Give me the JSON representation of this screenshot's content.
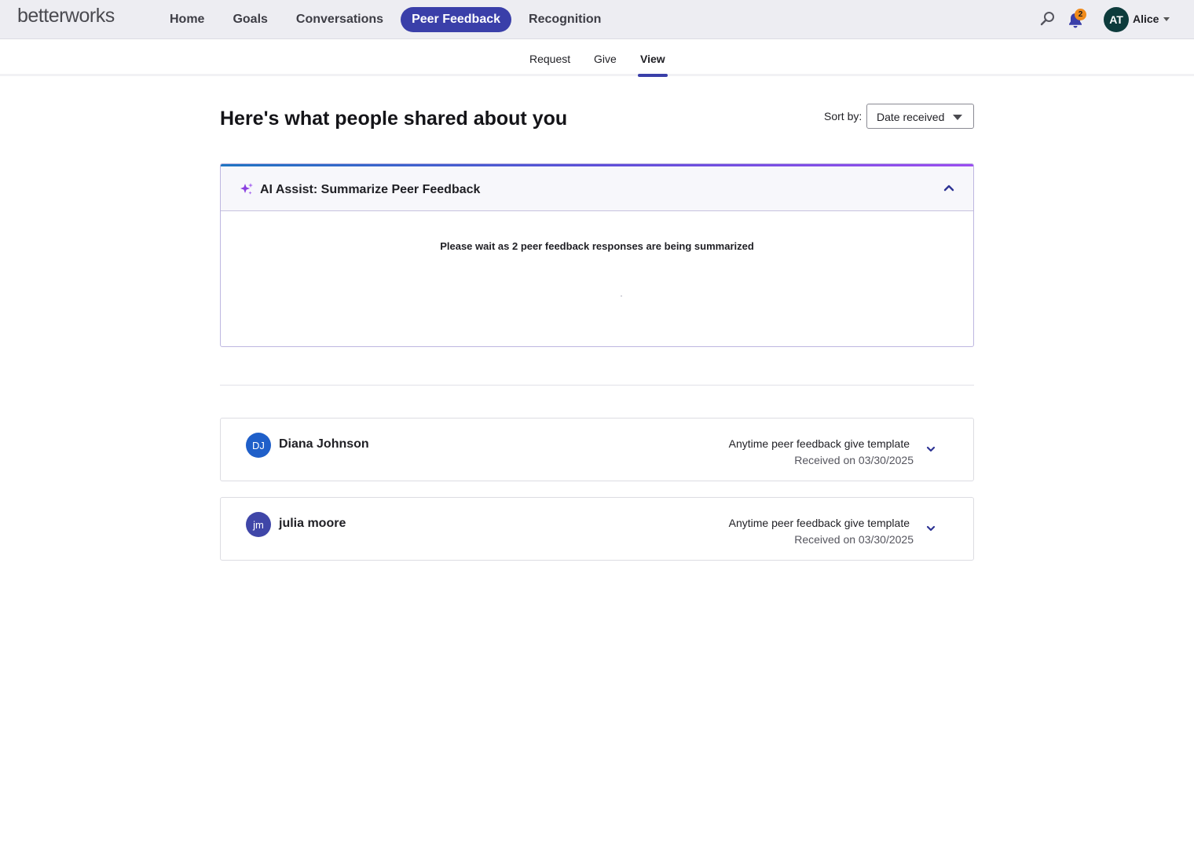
{
  "brand": {
    "logo_text": "betterworks"
  },
  "nav": {
    "items": [
      {
        "label": "Home",
        "active": false
      },
      {
        "label": "Goals",
        "active": false
      },
      {
        "label": "Conversations",
        "active": false
      },
      {
        "label": "Peer Feedback",
        "active": true
      },
      {
        "label": "Recognition",
        "active": false
      }
    ],
    "accent_color": "#3a3fa9"
  },
  "header": {
    "search_icon": "search-icon",
    "notifications": {
      "icon": "bell-icon",
      "count": "2",
      "badge_color": "#f08b1c"
    },
    "user": {
      "initials": "AT",
      "name": "Alice",
      "avatar_color": "#0d3b3c"
    }
  },
  "subnav": {
    "tabs": [
      {
        "label": "Request",
        "active": false
      },
      {
        "label": "Give",
        "active": false
      },
      {
        "label": "View",
        "active": true
      }
    ]
  },
  "main": {
    "title": "Here's what people shared about you",
    "sort": {
      "label": "Sort by:",
      "value": "Date received"
    }
  },
  "ai_assist": {
    "title": "AI Assist: Summarize Peer Feedback",
    "icon": "sparkle-icon",
    "expanded": true,
    "status_text": "Please wait as 2 peer feedback responses are being summarized"
  },
  "feedback": [
    {
      "initials": "DJ",
      "avatar_color": "#1f5fc9",
      "name": "Diana Johnson",
      "template": "Anytime peer feedback give template",
      "received": "Received on 03/30/2025"
    },
    {
      "initials": "jm",
      "avatar_color": "#3f46a8",
      "name": "julia moore",
      "template": "Anytime peer feedback give template",
      "received": "Received on 03/30/2025"
    }
  ]
}
